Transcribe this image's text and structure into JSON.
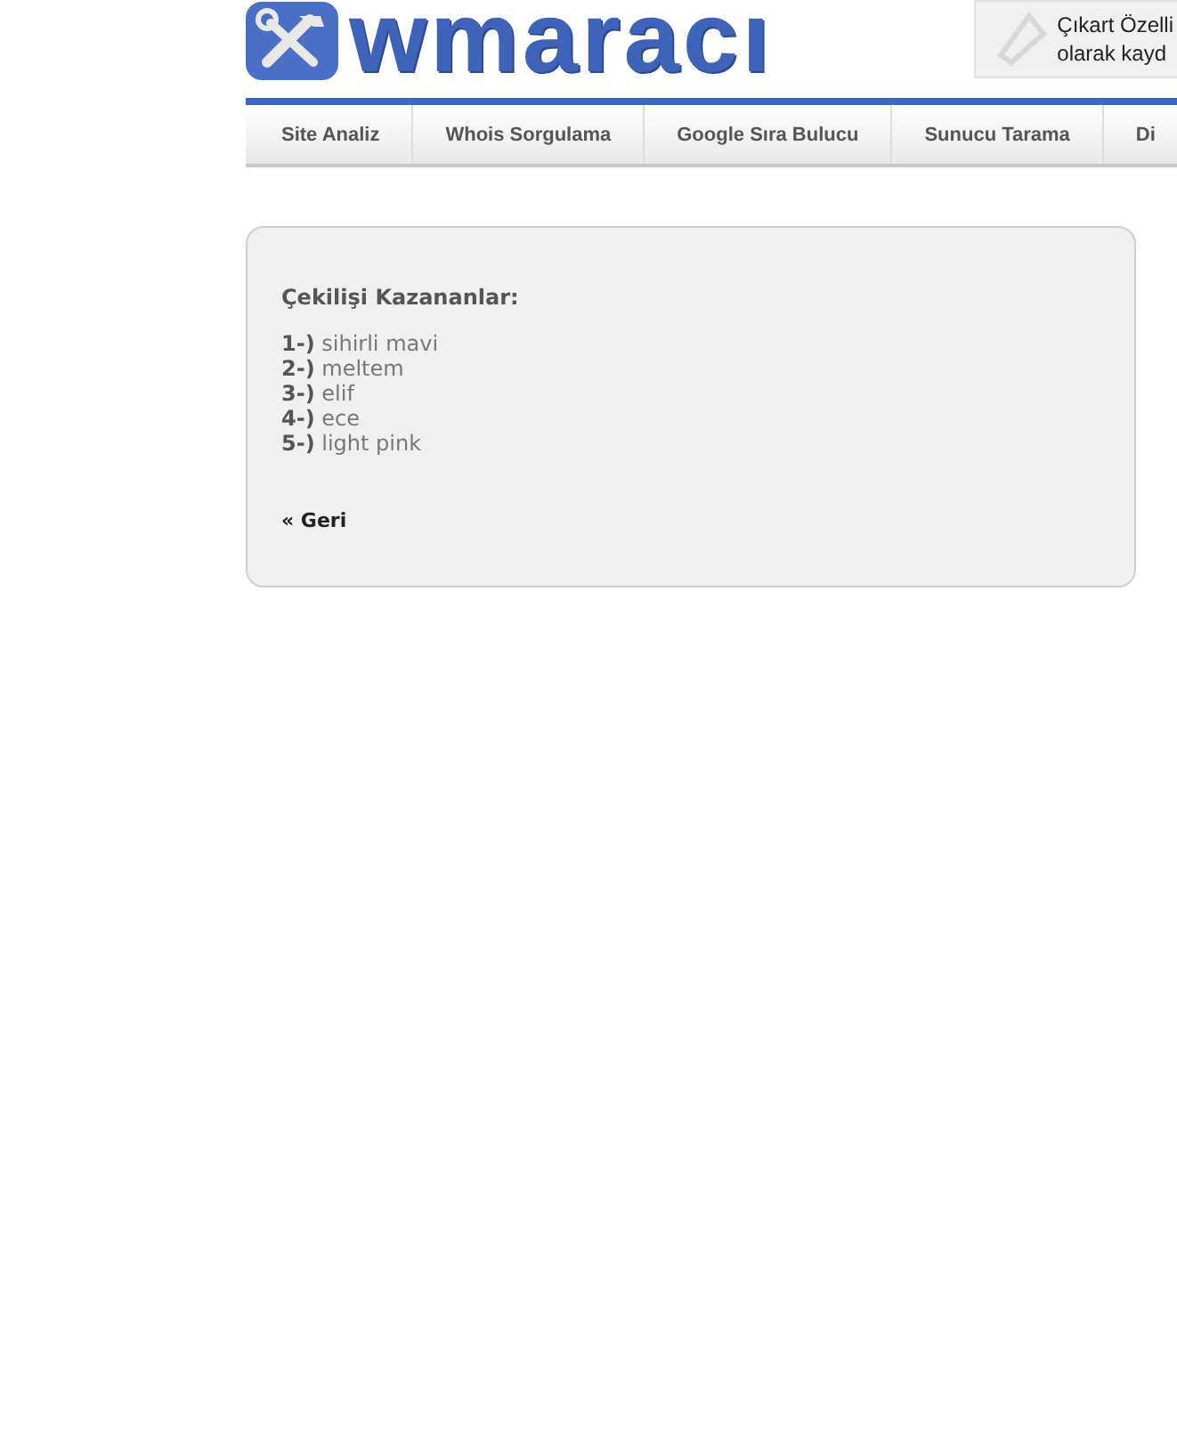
{
  "header": {
    "logo": "wmaracı",
    "ad_lines": [
      "Çıkart Özelli",
      "olarak kayd"
    ]
  },
  "nav": {
    "tabs": [
      {
        "label": "Site Analiz"
      },
      {
        "label": "Whois Sorgulama"
      },
      {
        "label": "Google Sıra Bulucu"
      },
      {
        "label": "Sunucu Tarama"
      },
      {
        "label": "Di"
      }
    ]
  },
  "content": {
    "title": "Çekilişi Kazananlar:",
    "winners": [
      {
        "number": "1-)",
        "name": "sihirli mavi"
      },
      {
        "number": "2-)",
        "name": "meltem"
      },
      {
        "number": "3-)",
        "name": "elif"
      },
      {
        "number": "4-)",
        "name": "ece"
      },
      {
        "number": "5-)",
        "name": "light pink"
      }
    ],
    "back_link": "« Geri"
  }
}
